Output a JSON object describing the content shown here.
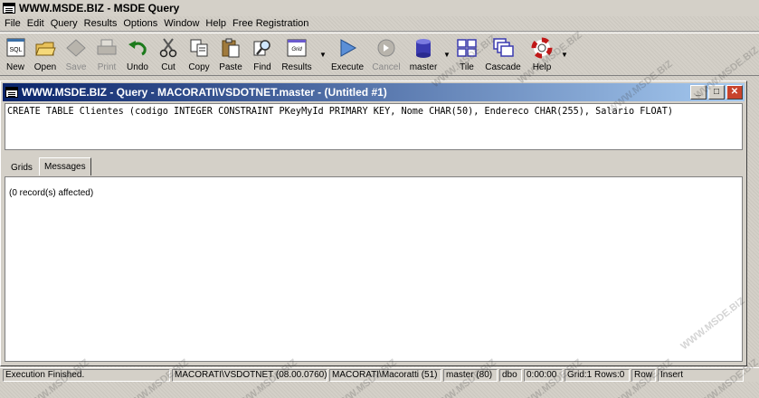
{
  "app": {
    "title": "WWW.MSDE.BIZ - MSDE Query"
  },
  "menu": [
    "File",
    "Edit",
    "Query",
    "Results",
    "Options",
    "Window",
    "Help",
    "Free Registration"
  ],
  "toolbar": {
    "new": "New",
    "open": "Open",
    "save": "Save",
    "print": "Print",
    "undo": "Undo",
    "cut": "Cut",
    "copy": "Copy",
    "paste": "Paste",
    "find": "Find",
    "results": "Results",
    "execute": "Execute",
    "cancel": "Cancel",
    "database": "master",
    "tile": "Tile",
    "cascade": "Cascade",
    "help": "Help",
    "grid_icon_label": "Grid",
    "sql_icon_label": "SQL"
  },
  "query_window": {
    "title": "WWW.MSDE.BIZ - Query - MACORATI\\VSDOTNET.master - (Untitled #1)",
    "query_text": "CREATE TABLE Clientes (codigo INTEGER CONSTRAINT PKeyMyId PRIMARY KEY, Nome CHAR(50), Endereco CHAR(255), Salario FLOAT)",
    "tabs": [
      "Grids",
      "Messages"
    ],
    "active_tab": "Messages",
    "message": "(0 record(s) affected)"
  },
  "status": {
    "state": "Execution Finished.",
    "server": "MACORATI\\VSDOTNET (08.00.0760)",
    "user": "MACORATI\\Macoratti (51)",
    "database": "master (80)",
    "schema": "dbo",
    "time": "0:00:00",
    "grid_rows": "Grid:1 Rows:0",
    "row": "Row",
    "insert": "Insert"
  },
  "watermark": "WWW.MSDE.BIZ",
  "colors": {
    "title_start": "#0a246a",
    "title_end": "#a6caf0",
    "close_button": "#c8432c"
  }
}
